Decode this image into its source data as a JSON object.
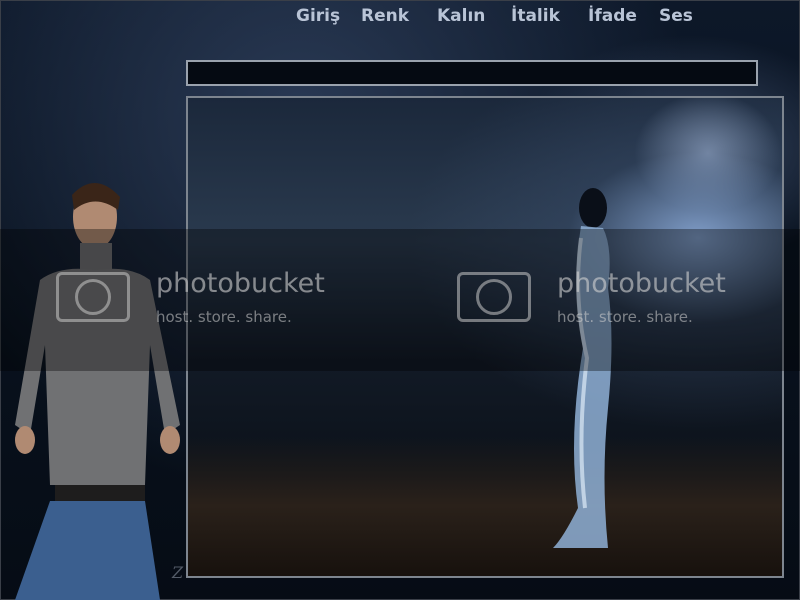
{
  "menu": {
    "items": [
      {
        "label": "Giriş"
      },
      {
        "label": "Renk"
      },
      {
        "label": "Kalın"
      },
      {
        "label": "İtalik"
      },
      {
        "label": "İfade"
      },
      {
        "label": "Ses"
      }
    ]
  },
  "chat_input": {
    "value": "",
    "placeholder": ""
  },
  "watermark": {
    "title": "photobucket",
    "subtitle": "host. store. share."
  },
  "signature": "Z",
  "colors": {
    "background": "#0a1220",
    "menu_text": "#b9c4d6",
    "input_border": "#9aa2ad",
    "panel_border": "#7d858f"
  }
}
